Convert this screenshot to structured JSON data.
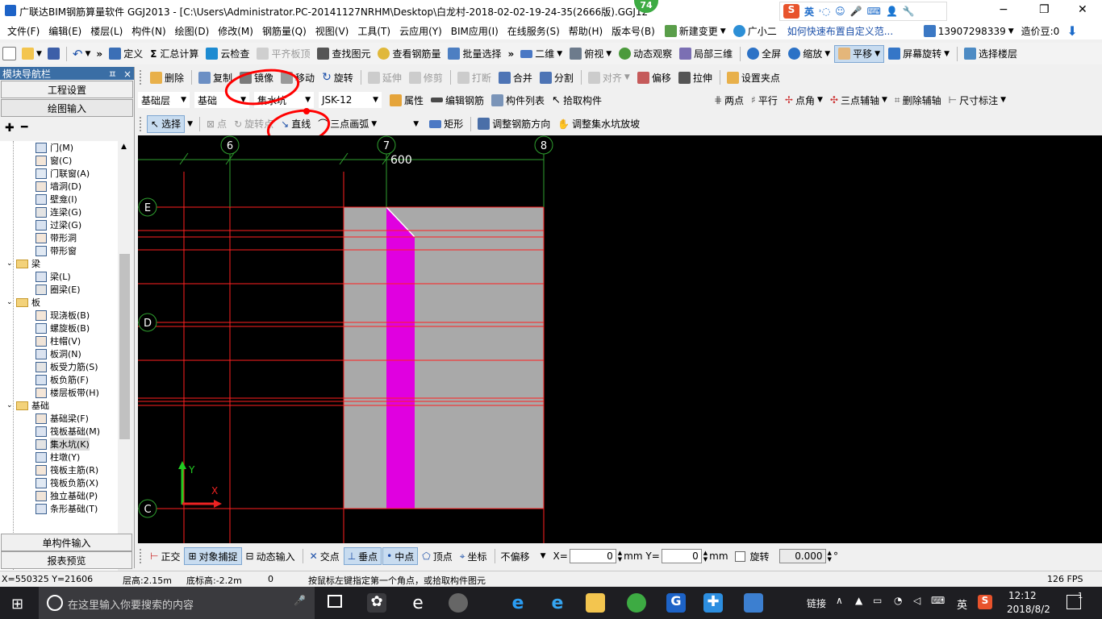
{
  "window": {
    "title": "广联达BIM钢筋算量软件 GGJ2013 - [C:\\Users\\Administrator.PC-20141127NRHM\\Desktop\\白龙村-2018-02-02-19-24-35(2666版).GGJ12",
    "badge": "74",
    "ime_text": "英",
    "minimize": "−",
    "maximize": "❐",
    "close": "✕"
  },
  "menu": {
    "items": [
      "文件(F)",
      "编辑(E)",
      "楼层(L)",
      "构件(N)",
      "绘图(D)",
      "修改(M)",
      "钢筋量(Q)",
      "视图(V)",
      "工具(T)",
      "云应用(Y)",
      "BIM应用(I)",
      "在线服务(S)",
      "帮助(H)",
      "版本号(B)"
    ],
    "new_change": "新建变更",
    "assistant": "广小二",
    "help_link": "如何快速布置自定义范...",
    "phone": "13907298339",
    "beans": "造价豆:0"
  },
  "toolbar1": {
    "define": "定义",
    "sum": "汇总计算",
    "cloud_check": "云检查",
    "flat_top": "平齐板顶",
    "find": "查找图元",
    "view_rebar": "查看钢筋量",
    "batch_select": "批量选择",
    "view2d": "二维",
    "topview": "俯视",
    "dynamic": "动态观察",
    "local3d": "局部三维",
    "fullscreen": "全屏",
    "zoom": "缩放",
    "pan": "平移",
    "rotate_screen": "屏幕旋转",
    "select_floor": "选择楼层"
  },
  "toolbar2": {
    "delete": "删除",
    "copy": "复制",
    "mirror": "镜像",
    "move": "移动",
    "rotate": "旋转",
    "extend": "延伸",
    "trim": "修剪",
    "break": "打断",
    "merge": "合并",
    "split": "分割",
    "align": "对齐",
    "offset": "偏移",
    "stretch": "拉伸",
    "set_grip": "设置夹点"
  },
  "toolbar3": {
    "layer": "基础层",
    "floor": "基础",
    "type": "集水坑",
    "element": "JSK-12",
    "property": "属性",
    "edit_rebar": "编辑钢筋",
    "element_list": "构件列表",
    "pick_element": "拾取构件",
    "two_point": "两点",
    "parallel": "平行",
    "point_angle": "点角",
    "three_point_axis": "三点辅轴",
    "delete_axis": "删除辅轴",
    "dimension": "尺寸标注"
  },
  "toolbar4": {
    "select": "选择",
    "point": "点",
    "rotate_point": "旋转点",
    "line": "直线",
    "arc3": "三点画弧",
    "rect": "矩形",
    "adjust_rebar_dir": "调整钢筋方向",
    "adjust_pit_slope": "调整集水坑放坡"
  },
  "nav": {
    "title": "模块导航栏",
    "pin": "ㅍ",
    "close": "×",
    "project_settings": "工程设置",
    "drawing_input": "绘图输入",
    "tree": [
      {
        "label": "门(M)",
        "level": 2
      },
      {
        "label": "窗(C)",
        "level": 2
      },
      {
        "label": "门联窗(A)",
        "level": 2
      },
      {
        "label": "墙洞(D)",
        "level": 2
      },
      {
        "label": "壁龛(I)",
        "level": 2
      },
      {
        "label": "连梁(G)",
        "level": 2
      },
      {
        "label": "过梁(G)",
        "level": 2
      },
      {
        "label": "带形洞",
        "level": 2
      },
      {
        "label": "带形窗",
        "level": 2
      },
      {
        "label": "梁",
        "level": 1
      },
      {
        "label": "梁(L)",
        "level": 2
      },
      {
        "label": "圈梁(E)",
        "level": 2
      },
      {
        "label": "板",
        "level": 1
      },
      {
        "label": "现浇板(B)",
        "level": 2
      },
      {
        "label": "螺旋板(B)",
        "level": 2
      },
      {
        "label": "柱帽(V)",
        "level": 2
      },
      {
        "label": "板洞(N)",
        "level": 2
      },
      {
        "label": "板受力筋(S)",
        "level": 2
      },
      {
        "label": "板负筋(F)",
        "level": 2
      },
      {
        "label": "楼层板带(H)",
        "level": 2
      },
      {
        "label": "基础",
        "level": 1
      },
      {
        "label": "基础梁(F)",
        "level": 2
      },
      {
        "label": "筏板基础(M)",
        "level": 2
      },
      {
        "label": "集水坑(K)",
        "level": 2
      },
      {
        "label": "柱墩(Y)",
        "level": 2
      },
      {
        "label": "筏板主筋(R)",
        "level": 2
      },
      {
        "label": "筏板负筋(X)",
        "level": 2
      },
      {
        "label": "独立基础(P)",
        "level": 2
      },
      {
        "label": "条形基础(T)",
        "level": 2
      }
    ],
    "single_input": "单构件输入",
    "report_preview": "报表预览"
  },
  "canvas": {
    "axis_cols": [
      "6",
      "7",
      "8"
    ],
    "axis_rows": [
      "E",
      "D",
      "C"
    ],
    "dimension": "600",
    "ucs_x": "X",
    "ucs_y": "Y",
    "colors": {
      "grid": "#ff2020",
      "pit": "#e000e0",
      "slab": "#a9a9a9",
      "axis": "#2fa02f"
    }
  },
  "snapbar": {
    "ortho": "正交",
    "snap": "对象捕捉",
    "dynamic_input": "动态输入",
    "intersect": "交点",
    "perpendicular": "垂点",
    "midpoint": "中点",
    "vertex": "顶点",
    "coordinate": "坐标",
    "offset_mode": "不偏移",
    "x_label": "X=",
    "x_value": "0",
    "y_label": "mm Y=",
    "y_value": "0",
    "mm": "mm",
    "rotate_label": "旋转",
    "rotate_value": "0.000",
    "degree": "°"
  },
  "status": {
    "coords": "X=550325 Y=21606",
    "floor_height": "层高:2.15m",
    "bottom_height": "底标高:-2.2m",
    "zero": "0",
    "hint": "按鼠标左键指定第一个角点，或拾取构件图元",
    "fps": "126 FPS"
  },
  "taskbar": {
    "search_placeholder": "在这里输入你要搜索的内容",
    "link": "链接",
    "lang": "英",
    "time": "12:12",
    "date": "2018/8/2",
    "notif": "1"
  }
}
